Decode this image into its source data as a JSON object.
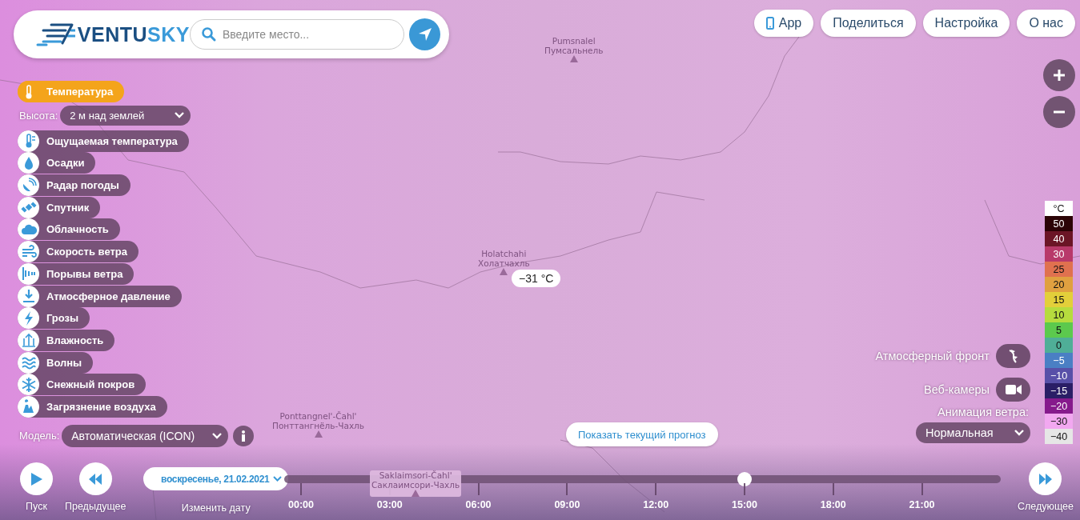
{
  "header": {
    "logo": {
      "dark_part": "VENTU",
      "light_part": "SKY"
    },
    "search": {
      "placeholder": "Введите место..."
    }
  },
  "top_menu": [
    {
      "label": "App",
      "kind": "app"
    },
    {
      "label": "Поделиться",
      "kind": "plain"
    },
    {
      "label": "Настройка",
      "kind": "plain"
    },
    {
      "label": "О нас",
      "kind": "plain"
    }
  ],
  "layers": [
    {
      "label": "Температура",
      "kind": "temperature",
      "selected": true
    },
    {
      "label": "Ощущаемая температура",
      "kind": "feels",
      "selected": false
    },
    {
      "label": "Осадки",
      "kind": "rain",
      "selected": false
    },
    {
      "label": "Радар погоды",
      "kind": "radar",
      "selected": false
    },
    {
      "label": "Спутник",
      "kind": "satellite",
      "selected": false
    },
    {
      "label": "Облачность",
      "kind": "cloud",
      "selected": false
    },
    {
      "label": "Скорость ветра",
      "kind": "wind",
      "selected": false
    },
    {
      "label": "Порывы ветра",
      "kind": "gust",
      "selected": false
    },
    {
      "label": "Атмосферное давление",
      "kind": "pressure",
      "selected": false
    },
    {
      "label": "Грозы",
      "kind": "storm",
      "selected": false
    },
    {
      "label": "Влажность",
      "kind": "humidity",
      "selected": false
    },
    {
      "label": "Волны",
      "kind": "waves",
      "selected": false
    },
    {
      "label": "Снежный покров",
      "kind": "snow",
      "selected": false
    },
    {
      "label": "Загрязнение воздуха",
      "kind": "pollution",
      "selected": false
    }
  ],
  "height": {
    "label": "Высота:",
    "value": "2 м над землей"
  },
  "model": {
    "label": "Модель:",
    "value": "Автоматическая (ICON)"
  },
  "map": {
    "places": [
      {
        "latin": "Pumsnalel",
        "cyrillic": "Пумсальнель"
      },
      {
        "latin": "Holatchahi",
        "cyrillic": "Холатчахль"
      },
      {
        "latin": "Ponttangnel'-Čahl'",
        "cyrillic": "Понттангнёль-Чахль"
      },
      {
        "latin": "Saklaimsori-Čahl'",
        "cyrillic": "Саклаимсори-Чахль"
      }
    ],
    "temperature_label": "−31 °C"
  },
  "legend": {
    "unit": "°C",
    "steps": [
      {
        "label": "50",
        "color": "#2b0306"
      },
      {
        "label": "40",
        "color": "#6b1526"
      },
      {
        "label": "30",
        "color": "#b8396a"
      },
      {
        "label": "25",
        "color": "#e0714f"
      },
      {
        "label": "20",
        "color": "#e0a040"
      },
      {
        "label": "15",
        "color": "#e3cf3a"
      },
      {
        "label": "10",
        "color": "#b6dc3e"
      },
      {
        "label": "5",
        "color": "#5cc94d"
      },
      {
        "label": "0",
        "color": "#4fae97"
      },
      {
        "label": "−5",
        "color": "#4a7fc4"
      },
      {
        "label": "−10",
        "color": "#5850a8"
      },
      {
        "label": "−15",
        "color": "#2a1e66"
      },
      {
        "label": "−20",
        "color": "#861a8c"
      },
      {
        "label": "−30",
        "color": "#f2a8f0"
      },
      {
        "label": "−40",
        "color": "#e6e6e6"
      }
    ]
  },
  "overlays": [
    {
      "label": "Атмосферный фронт",
      "kind": "front"
    },
    {
      "label": "Веб-камеры",
      "kind": "webcam"
    }
  ],
  "wind_animation": {
    "label": "Анимация ветра:",
    "value": "Нормальная"
  },
  "show_current_button": "Показать текущий прогноз",
  "timeline": {
    "play": "Пуск",
    "previous": "Предыдущее",
    "next": "Следующее",
    "date": "воскресенье, 21.02.2021",
    "change_date": "Изменить дату",
    "ticks": [
      "00:00",
      "03:00",
      "06:00",
      "09:00",
      "12:00",
      "15:00",
      "18:00",
      "21:00"
    ],
    "level": 0.642
  }
}
